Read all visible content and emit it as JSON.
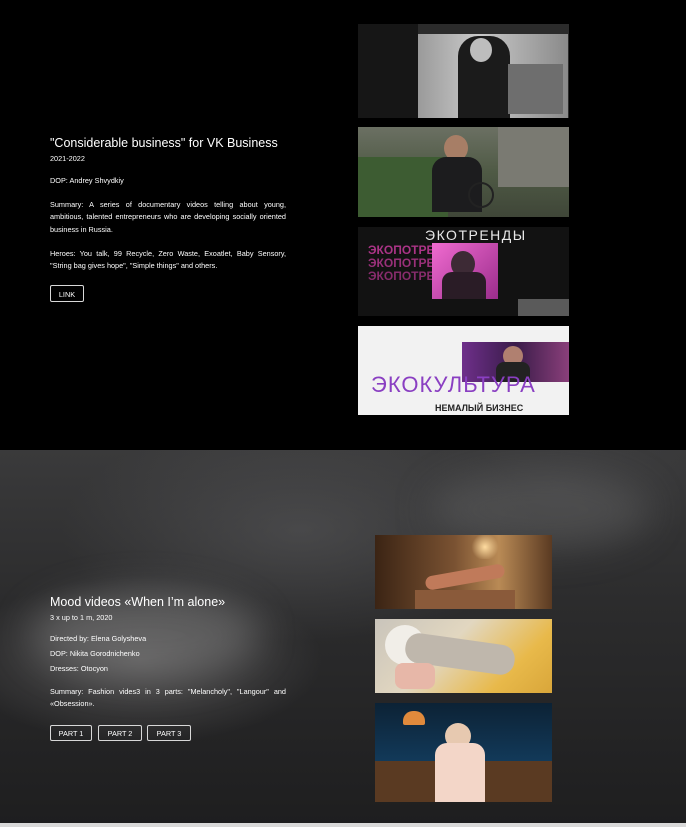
{
  "project1": {
    "title": "\"Considerable business\" for VK Business",
    "years": "2021-2022",
    "dop": "DOP: Andrey Shvydkiy",
    "summary": "Summary: A series of documentary videos telling about young, ambitious, talented entrepreneurs who are developing socially oriented business in Russia.",
    "heroes": "Heroes: You talk, 99 Recycle, Zero Waste, Exoatlet, Baby Sensory, \"String bag gives hope\", \"Simple things\" and others.",
    "link_label": "LINK",
    "thumbnails": {
      "thumb3_title": "ЭКОТРЕНДЫ",
      "thumb3_repeat": "ЭКОПОТРЕБЛЕНИЕ",
      "thumb4_title": "ЭКОКУЛЬТУРА",
      "thumb4_subtitle": "НЕМАЛЫЙ БИЗНЕС"
    }
  },
  "project2": {
    "title": "Mood videos «When I’m alone»",
    "meta": "3 x up to 1 m, 2020",
    "director": "Directed by: Elena Golysheva",
    "dop": "DOP: Nikita Gorodnichenko",
    "dresses": "Dresses: Otocyon",
    "summary": "Summary: Fashion vides3 in 3 parts: \"Melancholy\", \"Langour\" and «Obsession».",
    "buttons": [
      "PART 1",
      "PART 2",
      "PART 3"
    ]
  }
}
